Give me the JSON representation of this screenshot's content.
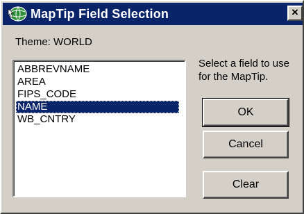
{
  "window": {
    "title": "MapTip Field Selection",
    "close_label": "×"
  },
  "theme": {
    "label": "Theme: WORLD"
  },
  "fields": {
    "items": [
      "ABBREVNAME",
      "AREA",
      "FIPS_CODE",
      "NAME",
      "WB_CNTRY"
    ],
    "selected": "NAME"
  },
  "hint": {
    "text": "Select a field to use for the MapTip."
  },
  "buttons": {
    "ok": "OK",
    "cancel": "Cancel",
    "clear": "Clear"
  },
  "colors": {
    "titlebar": "#0a246a",
    "face": "#d4d0c8",
    "selection": "#0a246a"
  },
  "icons": {
    "app": "globe-pointer-icon",
    "close": "close-icon"
  }
}
